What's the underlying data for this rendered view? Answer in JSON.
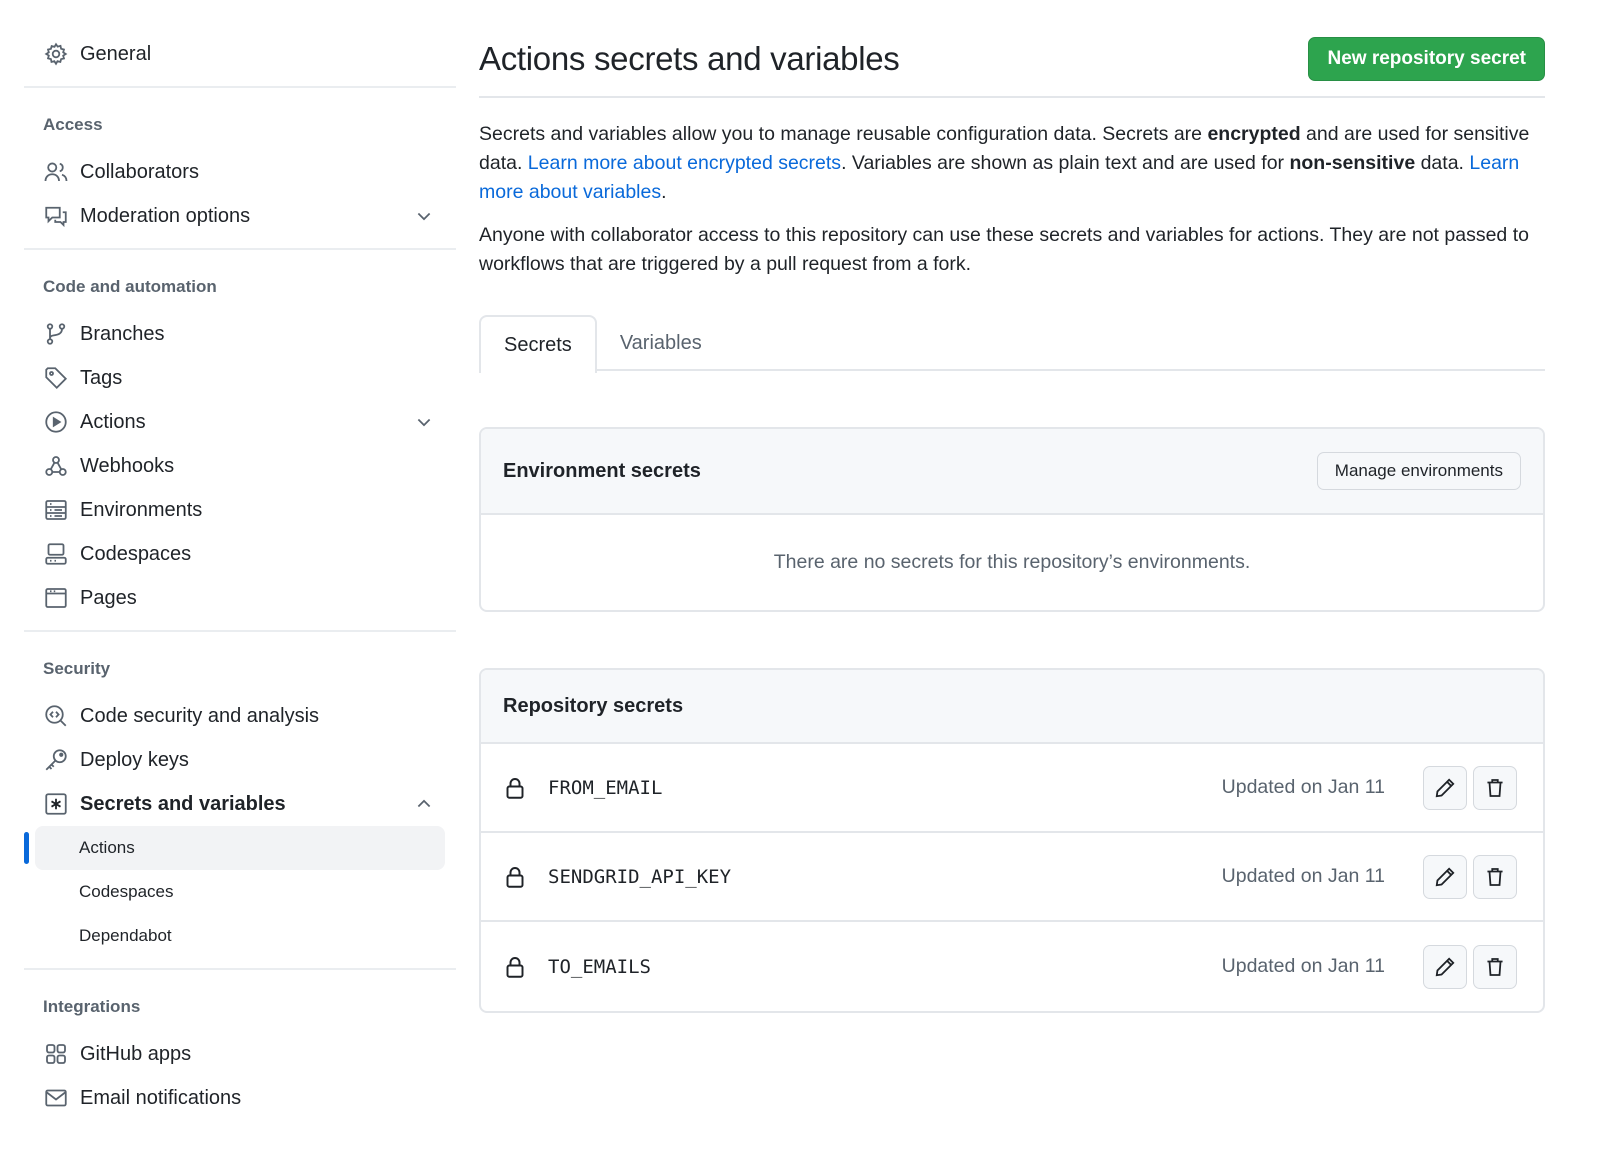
{
  "sidebar": {
    "general": {
      "label": "General",
      "icon": "gear-icon"
    },
    "sections": {
      "access": {
        "heading": "Access",
        "items": [
          {
            "label": "Collaborators",
            "icon": "people-icon"
          },
          {
            "label": "Moderation options",
            "icon": "comment-discussion-icon",
            "expandable": true
          }
        ]
      },
      "code": {
        "heading": "Code and automation",
        "items": [
          {
            "label": "Branches",
            "icon": "git-branch-icon"
          },
          {
            "label": "Tags",
            "icon": "tag-icon"
          },
          {
            "label": "Actions",
            "icon": "play-icon",
            "expandable": true
          },
          {
            "label": "Webhooks",
            "icon": "webhook-icon"
          },
          {
            "label": "Environments",
            "icon": "server-icon"
          },
          {
            "label": "Codespaces",
            "icon": "codespaces-icon"
          },
          {
            "label": "Pages",
            "icon": "browser-icon"
          }
        ]
      },
      "security": {
        "heading": "Security",
        "items": [
          {
            "label": "Code security and analysis",
            "icon": "codescan-icon"
          },
          {
            "label": "Deploy keys",
            "icon": "key-icon"
          },
          {
            "label": "Secrets and variables",
            "icon": "key-asterisk-icon",
            "expanded": true
          }
        ],
        "subitems": [
          {
            "label": "Actions",
            "active": true
          },
          {
            "label": "Codespaces"
          },
          {
            "label": "Dependabot"
          }
        ]
      },
      "integrations": {
        "heading": "Integrations",
        "items": [
          {
            "label": "GitHub apps",
            "icon": "apps-icon"
          },
          {
            "label": "Email notifications",
            "icon": "mail-icon"
          }
        ]
      }
    }
  },
  "main": {
    "title": "Actions secrets and variables",
    "new_secret_button": "New repository secret",
    "description": {
      "p1_a": "Secrets and variables allow you to manage reusable configuration data. Secrets are ",
      "p1_bold1": "encrypted",
      "p1_b": " and are used for sensitive data. ",
      "p1_link1": "Learn more about encrypted secrets",
      "p1_c": ". Variables are shown as plain text and are used for ",
      "p1_bold2": "non-sensitive",
      "p1_d": " data. ",
      "p1_link2": "Learn more about variables",
      "p1_e": ".",
      "p2": "Anyone with collaborator access to this repository can use these secrets and variables for actions. They are not passed to workflows that are triggered by a pull request from a fork."
    },
    "tabs": [
      {
        "label": "Secrets",
        "selected": true
      },
      {
        "label": "Variables",
        "selected": false
      }
    ],
    "environment_secrets": {
      "title": "Environment secrets",
      "manage_button": "Manage environments",
      "empty_message": "There are no secrets for this repository’s environments."
    },
    "repository_secrets": {
      "title": "Repository secrets",
      "items": [
        {
          "name": "FROM_EMAIL",
          "updated": "Updated on Jan 11"
        },
        {
          "name": "SENDGRID_API_KEY",
          "updated": "Updated on Jan 11"
        },
        {
          "name": "TO_EMAILS",
          "updated": "Updated on Jan 11"
        }
      ]
    }
  },
  "colors": {
    "primary_button": "#2da44e",
    "link": "#0969da",
    "active_indicator": "#0969da",
    "muted_text": "#59636e"
  }
}
